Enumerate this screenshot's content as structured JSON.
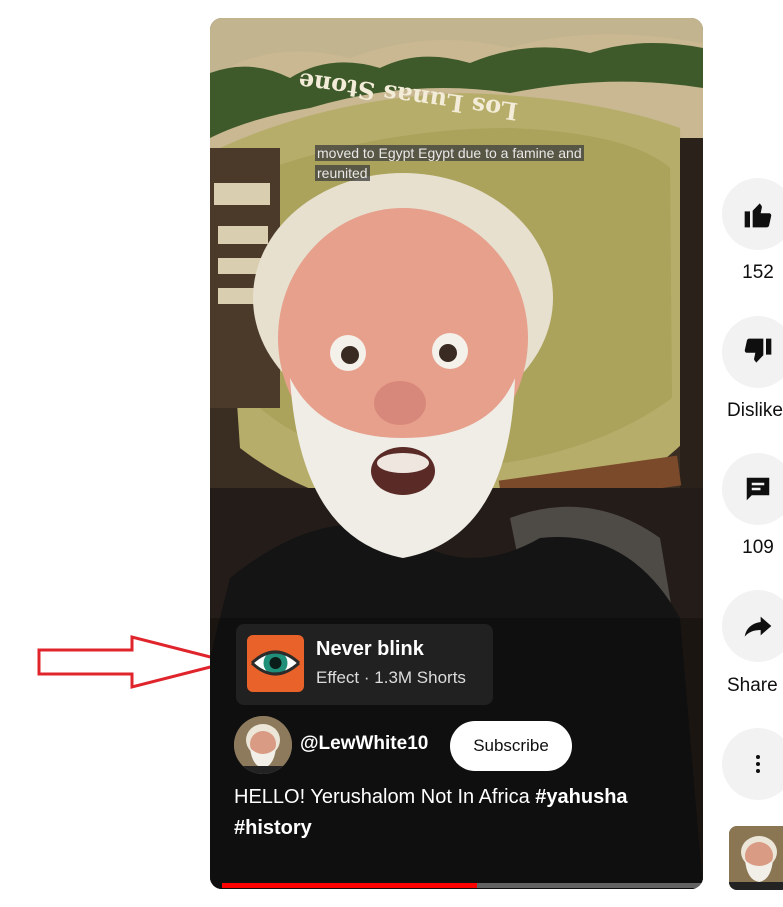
{
  "video": {
    "caption": "moved to Egypt Egypt due to a famine and reunited",
    "caption_line1": "moved to Egypt Egypt due to a famine and",
    "caption_line2": "reunited",
    "background_sign_text": "Los Lunas Stone",
    "effect": {
      "title": "Never blink",
      "subtitle": "Effect · 1.3M Shorts",
      "icon": "eye-icon"
    },
    "channel_handle": "@LewWhite10",
    "subscribe_label": "Subscribe",
    "title_line1_plain": "HELLO! Yerushalom Not In Africa ",
    "title_line1_tag": "#yahusha",
    "title_line2_tag": "#history",
    "progress_fraction": 0.53
  },
  "actions": {
    "like": {
      "icon": "thumbs-up-icon",
      "label": "152"
    },
    "dislike": {
      "icon": "thumbs-down-icon",
      "label": "Dislike"
    },
    "comments": {
      "icon": "comment-icon",
      "label": "109"
    },
    "share": {
      "icon": "share-icon",
      "label": "Share"
    },
    "more": {
      "icon": "more-vertical-icon"
    }
  },
  "annotation": {
    "icon": "red-arrow-icon",
    "color": "#e0242c"
  },
  "colors": {
    "accent": "#ff0000",
    "effect_tile": "#e8622a",
    "eye_iris": "#1f8f7a"
  }
}
